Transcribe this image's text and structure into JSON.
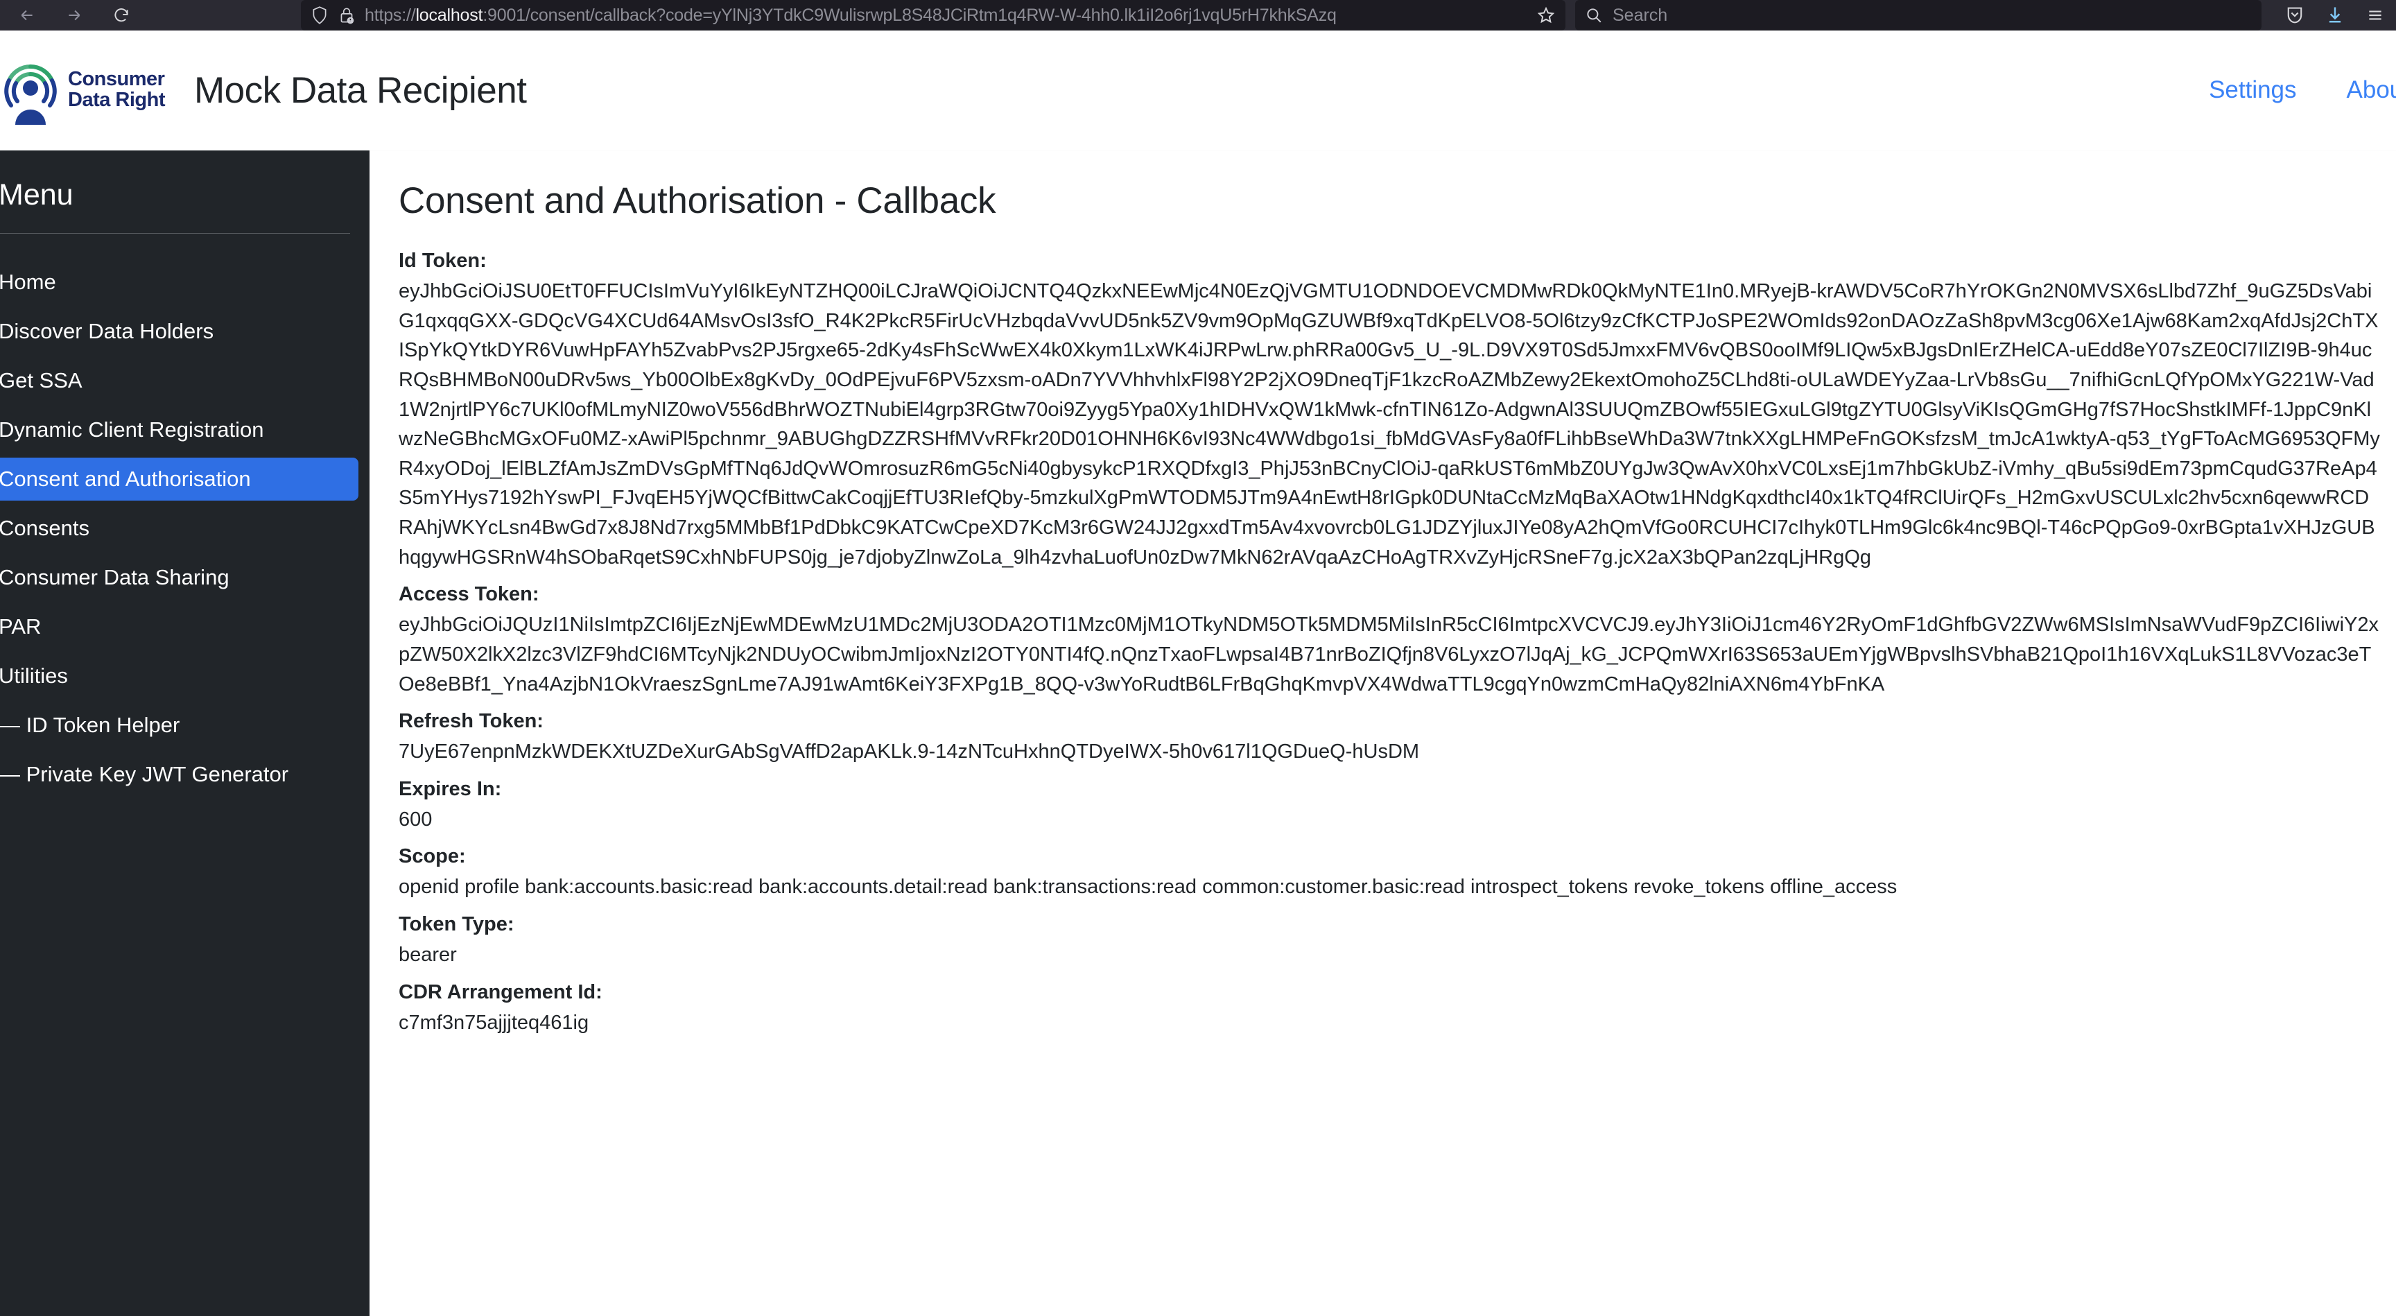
{
  "browser": {
    "back_icon": "arrow-left-icon",
    "forward_icon": "arrow-right-icon",
    "reload_icon": "reload-icon",
    "shield_icon": "shield-icon",
    "lock_warning_icon": "lock-warning-icon",
    "url_prefix": "https://",
    "url_host": "localhost",
    "url_rest": ":9001/consent/callback?code=yYlNj3YTdkC9WulisrwpL8S48JCiRtm1q4RW-W-4hh0.lk1iI2o6rj1vqU5rH7khkSAzq",
    "bookmark_icon": "star-icon",
    "search_placeholder": "Search",
    "search_icon": "search-icon",
    "pocket_icon": "pocket-icon",
    "download_icon": "download-icon",
    "menu_icon": "hamburger-menu-icon"
  },
  "header": {
    "logo_name": "cdr-logo",
    "logo_line1": "Consumer",
    "logo_line2": "Data Right",
    "app_title": "Mock Data Recipient",
    "nav": [
      {
        "label": "Settings",
        "name": "nav-link-settings"
      },
      {
        "label": "About",
        "name": "nav-link-about"
      }
    ]
  },
  "sidebar": {
    "title": "Menu",
    "items": [
      {
        "label": "Home",
        "name": "sidebar-item-home",
        "active": false,
        "sub": false
      },
      {
        "label": "Discover Data Holders",
        "name": "sidebar-item-discover-data-holders",
        "active": false,
        "sub": false
      },
      {
        "label": "Get SSA",
        "name": "sidebar-item-get-ssa",
        "active": false,
        "sub": false
      },
      {
        "label": "Dynamic Client Registration",
        "name": "sidebar-item-dynamic-client-registration",
        "active": false,
        "sub": false
      },
      {
        "label": "Consent and Authorisation",
        "name": "sidebar-item-consent-and-authorisation",
        "active": true,
        "sub": false
      },
      {
        "label": "Consents",
        "name": "sidebar-item-consents",
        "active": false,
        "sub": false
      },
      {
        "label": "Consumer Data Sharing",
        "name": "sidebar-item-consumer-data-sharing",
        "active": false,
        "sub": false
      },
      {
        "label": "PAR",
        "name": "sidebar-item-par",
        "active": false,
        "sub": false
      },
      {
        "label": "Utilities",
        "name": "sidebar-item-utilities",
        "active": false,
        "sub": false
      },
      {
        "label": "— ID Token Helper",
        "name": "sidebar-item-id-token-helper",
        "active": false,
        "sub": true
      },
      {
        "label": "— Private Key JWT Generator",
        "name": "sidebar-item-private-key-jwt-generator",
        "active": false,
        "sub": true
      }
    ]
  },
  "main": {
    "page_title": "Consent and Authorisation - Callback",
    "fields": [
      {
        "label": "Id Token:",
        "name": "id-token",
        "value": "eyJhbGciOiJSU0EtT0FFUCIsImVuYyI6IkEyNTZHQ00iLCJraWQiOiJCNTQ4QzkxNEEwMjc4N0EzQjVGMTU1ODNDOEVCMDMwRDk0QkMyNTE1In0.MRyejB-krAWDV5CoR7hYrOKGn2N0MVSX6sLlbd7Zhf_9uGZ5DsVabiG1qxqqGXX-GDQcVG4XCUd64AMsvOsI3sfO_R4K2PkcR5FirUcVHzbqdaVvvUD5nk5ZV9vm9OpMqGZUWBf9xqTdKpELVO8-5Ol6tzy9zCfKCTPJoSPE2WOmIds92onDAOzZaSh8pvM3cg06Xe1Ajw68Kam2xqAfdJsj2ChTXISpYkQYtkDYR6VuwHpFAYh5ZvabPvs2PJ5rgxe65-2dKy4sFhScWwEX4k0Xkym1LxWK4iJRPwLrw.phRRa00Gv5_U_-9L.D9VX9T0Sd5JmxxFMV6vQBS0ooIMf9LIQw5xBJgsDnIErZHelCA-uEdd8eY07sZE0Cl7IlZI9B-9h4ucRQsBHMBoN00uDRv5ws_Yb00OlbEx8gKvDy_0OdPEjvuF6PV5zxsm-oADn7YVVhhvhlxFl98Y2P2jXO9DneqTjF1kzcRoAZMbZewy2EkextOmohoZ5CLhd8ti-oULaWDEYyZaa-LrVb8sGu__7nifhiGcnLQfYpOMxYG221W-Vad1W2njrtlPY6c7UKl0ofMLmyNIZ0woV556dBhrWOZTNubiEl4grp3RGtw70oi9Zyyg5Ypa0Xy1hIDHVxQW1kMwk-cfnTIN61Zo-AdgwnAl3SUUQmZBOwf55IEGxuLGl9tgZYTU0GlsyViKIsQGmGHg7fS7HocShstkIMFf-1JppC9nKlwzNeGBhcMGxOFu0MZ-xAwiPl5pchnmr_9ABUGhgDZZRSHfMVvRFkr20D01OHNH6K6vI93Nc4WWdbgo1si_fbMdGVAsFy8a0fFLihbBseWhDa3W7tnkXXgLHMPeFnGOKsfzsM_tmJcA1wktyA-q53_tYgFToAcMG6953QFMyR4xyODoj_lElBLZfAmJsZmDVsGpMfTNq6JdQvWOmrosuzR6mG5cNi40gbysykcP1RXQDfxgI3_PhjJ53nBCnyClOiJ-qaRkUST6mMbZ0UYgJw3QwAvX0hxVC0LxsEj1m7hbGkUbZ-iVmhy_qBu5si9dEm73pmCqudG37ReAp4S5mYHys7192hYswPI_FJvqEH5YjWQCfBittwCakCoqjjEfTU3RIefQby-5mzkulXgPmWTODM5JTm9A4nEwtH8rIGpk0DUNtaCcMzMqBaXAOtw1HNdgKqxdthcI40x1kTQ4fRClUirQFs_H2mGxvUSCULxlc2hv5cxn6qewwRCDRAhjWKYcLsn4BwGd7x8J8Nd7rxg5MMbBf1PdDbkC9KATCwCpeXD7KcM3r6GW24JJ2gxxdTm5Av4xvovrcb0LG1JDZYjluxJIYe08yA2hQmVfGo0RCUHCI7cIhyk0TLHm9Glc6k4nc9BQl-T46cPQpGo9-0xrBGpta1vXHJzGUBhqgywHGSRnW4hSObaRqetS9CxhNbFUPS0jg_je7djobyZlnwZoLa_9lh4zvhaLuofUn0zDw7MkN62rAVqaAzCHoAgTRXvZyHjcRSneF7g.jcX2aX3bQPan2zqLjHRgQg"
      },
      {
        "label": "Access Token:",
        "name": "access-token",
        "value": "eyJhbGciOiJQUzI1NiIsImtpZCI6IjEzNjEwMDEwMzU1MDc2MjU3ODA2OTI1Mzc0MjM1OTkyNDM5OTk5MDM5MiIsInR5cCI6ImtpcXVCVCJ9.eyJhY3IiOiJ1cm46Y2RyOmF1dGhfbGV2ZWw6MSIsImNsaWVudF9pZCI6IiwiY2xpZW50X2lkX2lzc3VlZF9hdCI6MTcyNjk2NDUyOCwibmJmIjoxNzI2OTY0NTI4fQ.nQnzTxaoFLwpsaI4B71nrBoZIQfjn8V6LyxzO7lJqAj_kG_JCPQmWXrI63S653aUEmYjgWBpvslhSVbhaB21QpoI1h16VXqLukS1L8VVozac3eTOe8eBBf1_Yna4AzjbN1OkVraeszSgnLme7AJ91wAmt6KeiY3FXPg1B_8QQ-v3wYoRudtB6LFrBqGhqKmvpVX4WdwaTTL9cgqYn0wzmCmHaQy82lniAXN6m4YbFnKA"
      },
      {
        "label": "Refresh Token:",
        "name": "refresh-token",
        "value": "7UyE67enpnMzkWDEKXtUZDeXurGAbSgVAffD2apAKLk.9-14zNTcuHxhnQTDyeIWX-5h0v617l1QGDueQ-hUsDM"
      },
      {
        "label": "Expires In:",
        "name": "expires-in",
        "value": "600"
      },
      {
        "label": "Scope:",
        "name": "scope",
        "value": "openid profile bank:accounts.basic:read bank:accounts.detail:read bank:transactions:read common:customer.basic:read introspect_tokens revoke_tokens offline_access"
      },
      {
        "label": "Token Type:",
        "name": "token-type",
        "value": "bearer"
      },
      {
        "label": "CDR Arrangement Id:",
        "name": "cdr-arrangement-id",
        "value": "c7mf3n75ajjjteq461ig"
      }
    ]
  },
  "colors": {
    "sidebar_bg": "#212529",
    "accent": "#2f6fe4",
    "link": "#3b82f6",
    "chrome_bg": "#2b2a33",
    "urlbar_bg": "#1c1b22"
  }
}
